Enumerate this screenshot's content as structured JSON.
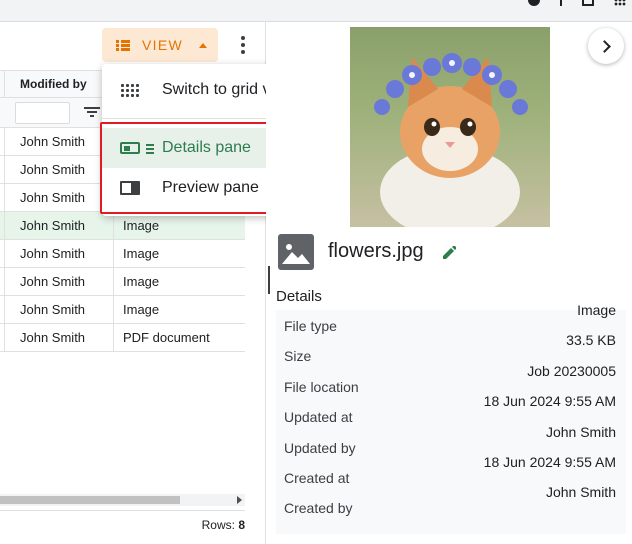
{
  "toolbar": {
    "view_label": "VIEW"
  },
  "table": {
    "column_header": "Modified by",
    "rows": [
      {
        "name": "John Smith",
        "type": ""
      },
      {
        "name": "John Smith",
        "type": ""
      },
      {
        "name": "John Smith",
        "type": ""
      },
      {
        "name": "John Smith",
        "type": "Image"
      },
      {
        "name": "John Smith",
        "type": "Image"
      },
      {
        "name": "John Smith",
        "type": "Image"
      },
      {
        "name": "John Smith",
        "type": "Image"
      },
      {
        "name": "John Smith",
        "type": "PDF document"
      }
    ],
    "selected_row_index": 3,
    "rows_label": "Rows:",
    "rows_count": "8"
  },
  "menu": {
    "items": [
      {
        "label": "Switch to grid view",
        "icon": "grid-icon"
      },
      {
        "label": "Details pane",
        "icon": "details-pane-icon",
        "active": true
      },
      {
        "label": "Preview pane",
        "icon": "preview-pane-icon"
      }
    ]
  },
  "details": {
    "file_name": "flowers.jpg",
    "section_title": "Details",
    "fields": [
      {
        "key": "File type",
        "value": "Image"
      },
      {
        "key": "Size",
        "value": "33.5 KB"
      },
      {
        "key": "File location",
        "value": "Job 20230005"
      },
      {
        "key": "Updated at",
        "value": "18 Jun 2024 9:55 AM"
      },
      {
        "key": "Updated by",
        "value": "John Smith"
      },
      {
        "key": "Created at",
        "value": "18 Jun 2024 9:55 AM"
      },
      {
        "key": "Created by",
        "value": "John Smith"
      }
    ]
  },
  "colors": {
    "accent_orange": "#e37400",
    "active_green": "#2e7d4f",
    "highlight_red": "#e01b22"
  }
}
